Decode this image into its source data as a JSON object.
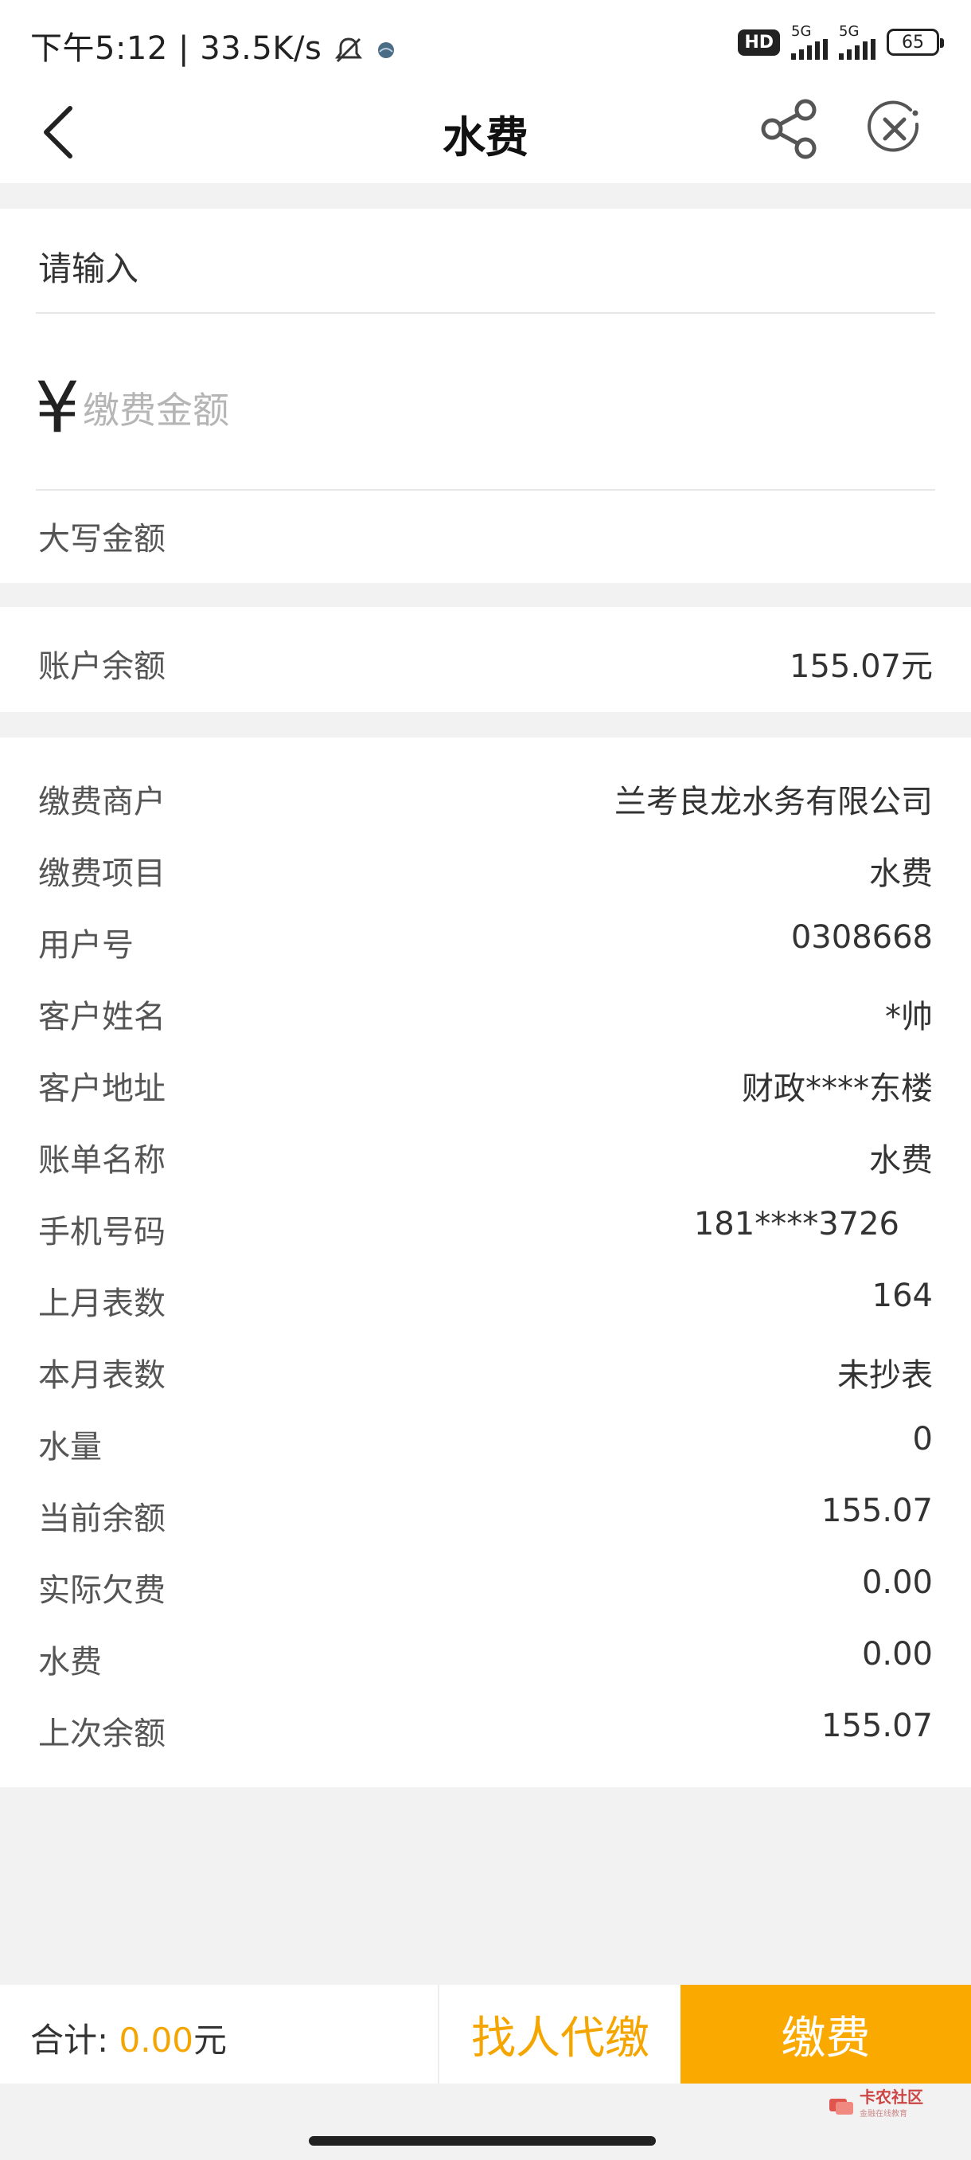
{
  "status_bar": {
    "time": "下午5:12",
    "speed": "33.5K/s",
    "hd": "HD",
    "net1": "5G",
    "net2": "5G",
    "battery": "65"
  },
  "header": {
    "title": "水费",
    "back_icon": "chevron-left-icon",
    "share_icon": "share-icon",
    "close_icon": "close-circle-icon"
  },
  "input_section": {
    "prompt": "请输入",
    "currency_symbol": "¥",
    "amount_placeholder": "缴费金额",
    "uppercase_label": "大写金额"
  },
  "balance": {
    "label": "账户余额",
    "value": "155.07元"
  },
  "details": [
    {
      "label": "缴费商户",
      "value": "兰考良龙水务有限公司"
    },
    {
      "label": "缴费项目",
      "value": "水费"
    },
    {
      "label": "用户号",
      "value": "0308668"
    },
    {
      "label": "客户姓名",
      "value": "*帅"
    },
    {
      "label": "客户地址",
      "value": "财政****东楼"
    },
    {
      "label": "账单名称",
      "value": "水费"
    },
    {
      "label": "手机号码",
      "value": "181****3726"
    },
    {
      "label": "上月表数",
      "value": "164"
    },
    {
      "label": "本月表数",
      "value": "未抄表"
    },
    {
      "label": "水量",
      "value": "0"
    },
    {
      "label": "当前余额",
      "value": "155.07"
    },
    {
      "label": "实际欠费",
      "value": "0.00"
    },
    {
      "label": "水费",
      "value": "0.00"
    },
    {
      "label": "上次余额",
      "value": "155.07"
    }
  ],
  "footer": {
    "total_label": "合计:",
    "total_amount": "0.00",
    "total_unit": "元",
    "agent_button": "找人代缴",
    "pay_button": "缴费"
  },
  "watermark": {
    "text": "卡农社区",
    "subtext": "金融在线教育"
  },
  "colors": {
    "accent": "#f9a900",
    "accent_text": "#f5a500",
    "background": "#f2f2f2"
  }
}
